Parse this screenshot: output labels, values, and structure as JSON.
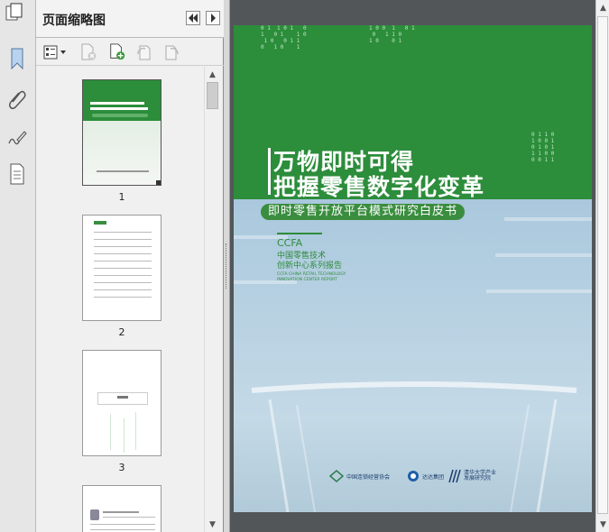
{
  "panel": {
    "title": "页面缩略图",
    "thumbnails": [
      {
        "label": "1"
      },
      {
        "label": "2"
      },
      {
        "label": "3"
      }
    ]
  },
  "left_strip": {
    "icons": [
      "bookmark-icon",
      "paperclip-icon",
      "signature-icon",
      "document-layers-icon"
    ]
  },
  "toolbar": {
    "icons": [
      "thumbnail-options-icon",
      "delete-page-icon",
      "insert-pages-icon",
      "rotate-left-icon",
      "rotate-right-icon"
    ]
  },
  "cover": {
    "title_line1": "万物即时可得",
    "title_line2": "把握零售数字化变革",
    "subtitle": "即时零售开放平台模式研究白皮书",
    "series_abbr": "CCFA",
    "series_cn_line1": "中国零售技术",
    "series_cn_line2": "创新中心系列报告",
    "series_en_line1": "CCFA CHINA RETAIL TECHNOLOGY",
    "series_en_line2": "INNOVATION CENTER REPORT",
    "logo1": "中国连锁经营协会",
    "logo2": "达达集团",
    "logo3": "清华大学产业发展研究院"
  },
  "colors": {
    "cover_green": "#2c8d3b",
    "cover_photo_blue": "#a9c7dc",
    "doc_background": "#525659"
  }
}
